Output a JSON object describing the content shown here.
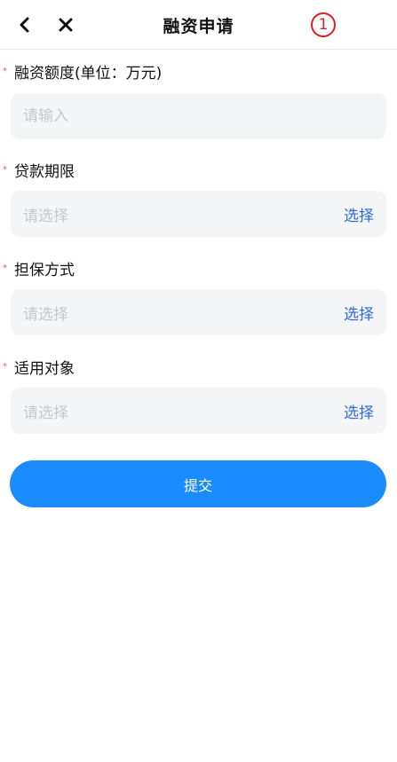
{
  "header": {
    "title": "融资申请",
    "badge": "1"
  },
  "form": {
    "amount": {
      "label": "融资额度(单位：万元)",
      "placeholder": "请输入",
      "value": ""
    },
    "term": {
      "label": "贷款期限",
      "placeholder": "请选择",
      "action": "选择"
    },
    "guarantee": {
      "label": "担保方式",
      "placeholder": "请选择",
      "action": "选择"
    },
    "target": {
      "label": "适用对象",
      "placeholder": "请选择",
      "action": "选择"
    },
    "required_mark": "*"
  },
  "submit_label": "提交",
  "colors": {
    "accent": "#1a8cff",
    "link": "#2f6bd8",
    "required": "#ff4d4f",
    "badge": "#e02020"
  },
  "icons": {
    "back": "chevron-left-icon",
    "close": "close-icon"
  }
}
